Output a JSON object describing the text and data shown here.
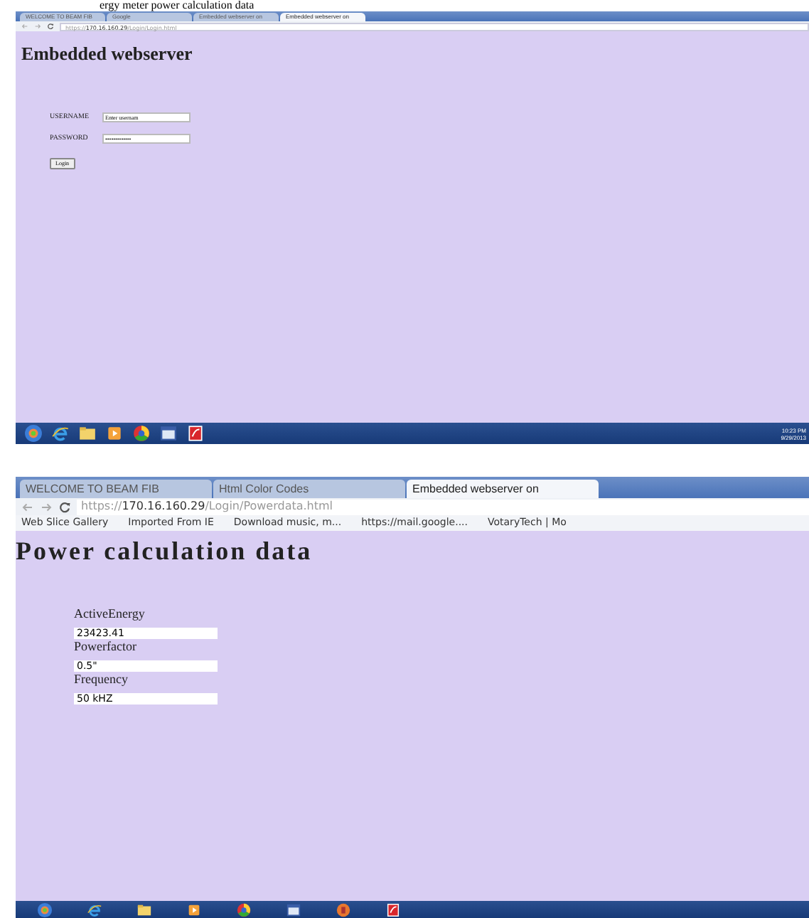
{
  "caption": "ergy meter power calculation data",
  "screens": [
    {
      "kind": "login",
      "tabs": [
        {
          "label": "WELCOME TO BEAM FIB",
          "selected": false
        },
        {
          "label": "Google",
          "selected": false
        },
        {
          "label": "Embedded webserver on",
          "selected": false
        },
        {
          "label": "Embedded webserver on",
          "selected": true
        }
      ],
      "url": {
        "scheme": "https://",
        "host": "170.16.160.29",
        "path": "/Login/Login.html"
      },
      "heading": "Embedded webserver",
      "fields": [
        {
          "label": "USERNAME",
          "value": "Enter usernam"
        },
        {
          "label": "PASSWORD",
          "value": "•••••••••••••"
        }
      ],
      "button": "Login",
      "taskbar": [
        {
          "kind": "start"
        },
        {
          "kind": "ie"
        },
        {
          "kind": "folder"
        },
        {
          "kind": "media"
        },
        {
          "kind": "chrome"
        },
        {
          "kind": "window"
        },
        {
          "kind": "red"
        }
      ],
      "clock": {
        "time": "10:23 PM",
        "date": "9/29/2013"
      }
    },
    {
      "kind": "data",
      "tabs": [
        {
          "label": "WELCOME TO BEAM FIB",
          "selected": false
        },
        {
          "label": "Html Color Codes",
          "selected": false
        },
        {
          "label": "Embedded webserver on",
          "selected": true
        }
      ],
      "url": {
        "scheme": "https://",
        "host": "170.16.160.29",
        "path": "/Login/Powerdata.html"
      },
      "bookmarks": [
        "Web Slice Gallery",
        "Imported From IE",
        "Download music, m...",
        "https://mail.google....",
        "VotaryTech | Mo"
      ],
      "heading": "Power calculation data",
      "fields": [
        {
          "label": "ActiveEnergy",
          "value": "23423.41"
        },
        {
          "label": "Powerfactor",
          "value": "0.5\""
        },
        {
          "label": "Frequency",
          "value": "50 kHZ"
        }
      ],
      "taskbar": [
        {
          "kind": "start"
        },
        {
          "kind": "ie"
        },
        {
          "kind": "folder"
        },
        {
          "kind": "media"
        },
        {
          "kind": "chrome"
        },
        {
          "kind": "window"
        },
        {
          "kind": "orange"
        },
        {
          "kind": "red"
        }
      ]
    }
  ]
}
